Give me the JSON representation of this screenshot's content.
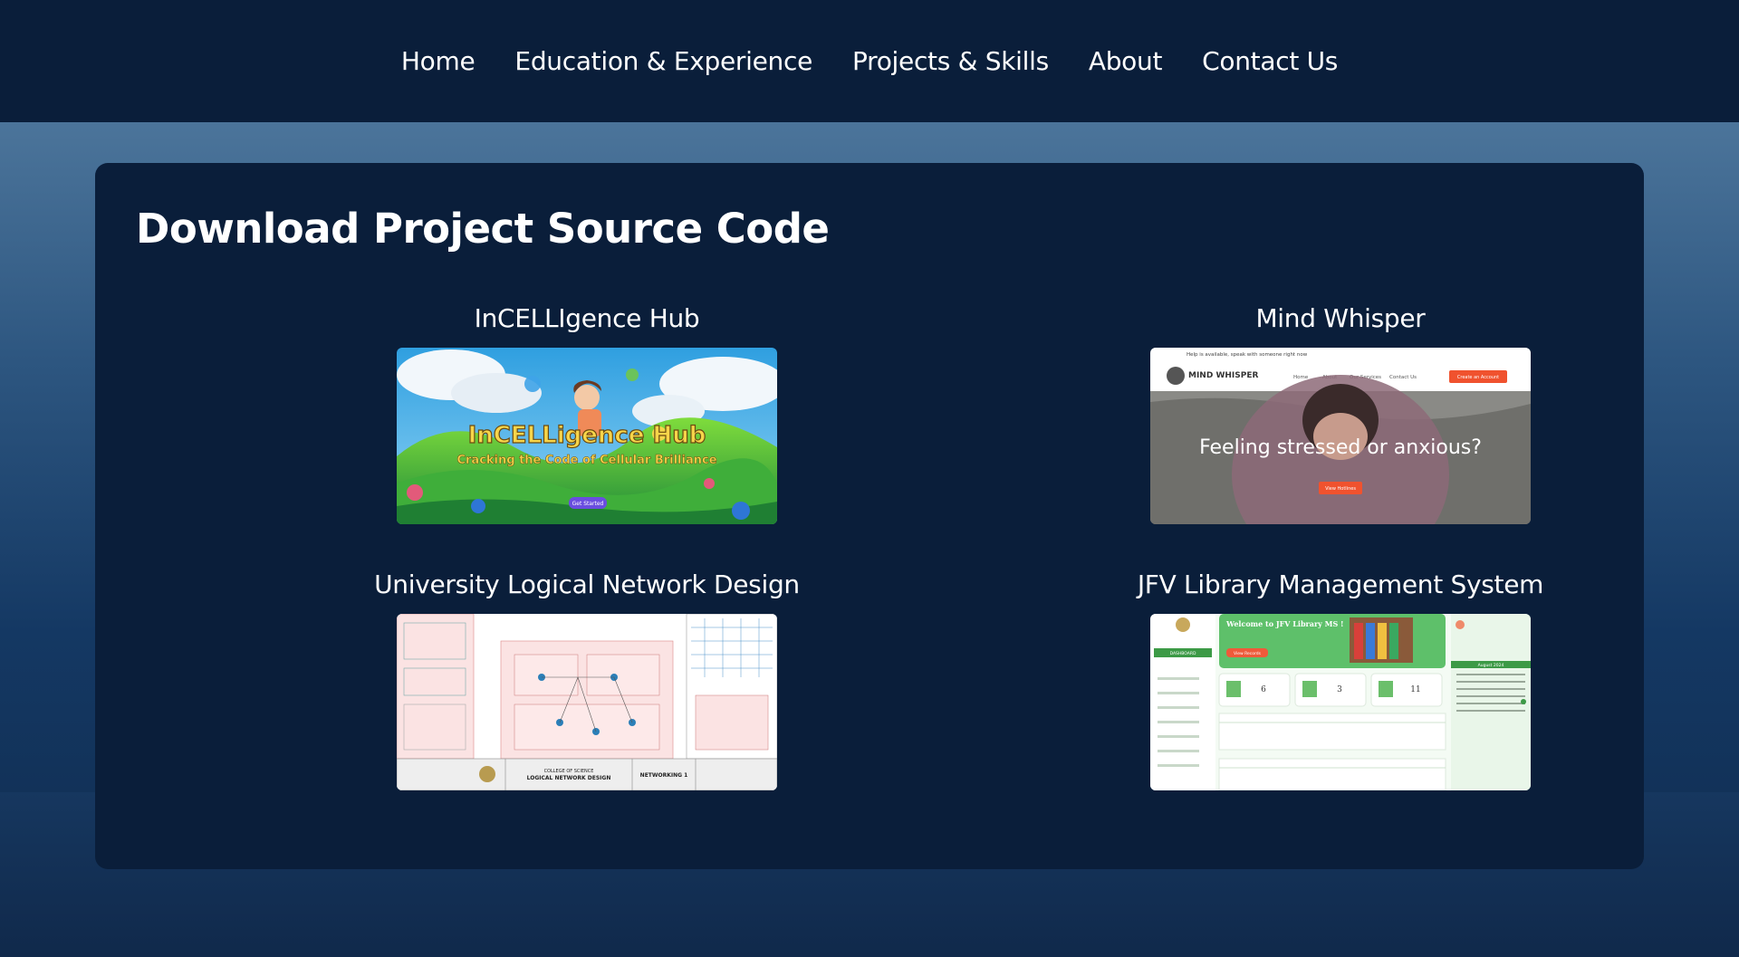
{
  "nav": {
    "items": [
      {
        "label": "Home"
      },
      {
        "label": "Education & Experience"
      },
      {
        "label": "Projects & Skills"
      },
      {
        "label": "About"
      },
      {
        "label": "Contact Us"
      }
    ]
  },
  "section": {
    "title": "Download Project Source Code"
  },
  "projects": [
    {
      "title": "InCELLIgence Hub",
      "image_heading": "InCELLigence Hub",
      "image_subheading": "Cracking the Code of Cellular Brilliance",
      "image_button": "Get Started"
    },
    {
      "title": "Mind Whisper",
      "image_topbar": "Help is available, speak with someone right now",
      "image_brand": "MIND WHISPER",
      "image_nav": [
        "Home",
        "About",
        "Our Services",
        "Contact Us"
      ],
      "image_cta": "Create an Account",
      "image_heading": "Feeling stressed or anxious?",
      "image_button": "View Hotlines"
    },
    {
      "title": "University Logical Network Design",
      "image_footer": [
        "COLLEGE OF SCIENCE",
        "LOGICAL NETWORK DESIGN",
        "NETWORKING 1"
      ]
    },
    {
      "title": "JFV Library Management System",
      "image_heading": "Welcome to JFV Library MS !",
      "image_button": "View Records",
      "image_stats": [
        "6",
        "3",
        "11"
      ],
      "image_sidebar_active": "DASHBOARD",
      "image_calendar": "August 2024"
    }
  ],
  "colors": {
    "nav_bg": "#0a1e3a",
    "card_bg": "#0a1e3a",
    "text": "#ffffff"
  }
}
